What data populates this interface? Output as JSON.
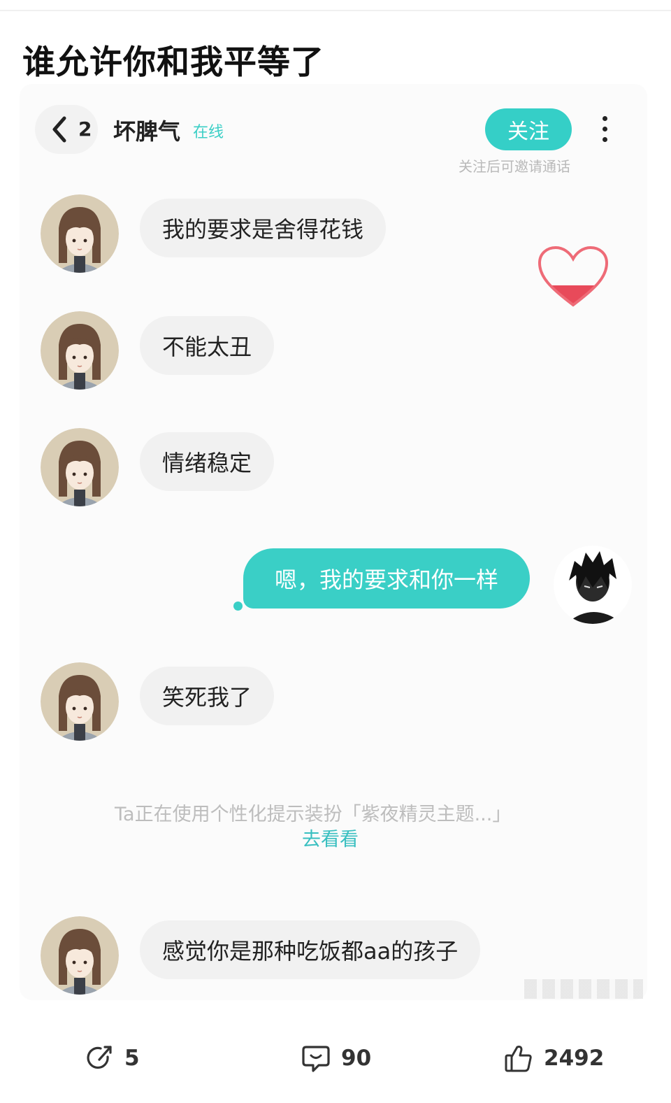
{
  "post": {
    "title": "谁允许你和我平等了"
  },
  "chat_header": {
    "back_count": "2",
    "contact_name": "坏脾气",
    "status": "在线",
    "follow_label": "关注",
    "follow_hint": "关注后可邀请通话"
  },
  "messages": {
    "m1": "我的要求是舍得花钱",
    "m2": "不能太丑",
    "m3": "情绪稳定",
    "m4": "嗯，我的要求和你一样",
    "m5": "笑死我了",
    "m6": "感觉你是那种吃饭都aa的孩子"
  },
  "theme_notice": {
    "text": "Ta正在使用个性化提示装扮「紫夜精灵主题...」",
    "link": "去看看"
  },
  "actions": {
    "repost_count": "5",
    "comment_count": "90",
    "like_count": "2492"
  },
  "colors": {
    "accent": "#3acfc6",
    "bubble_in": "#f1f1f1",
    "heart": "#e84a5a"
  }
}
